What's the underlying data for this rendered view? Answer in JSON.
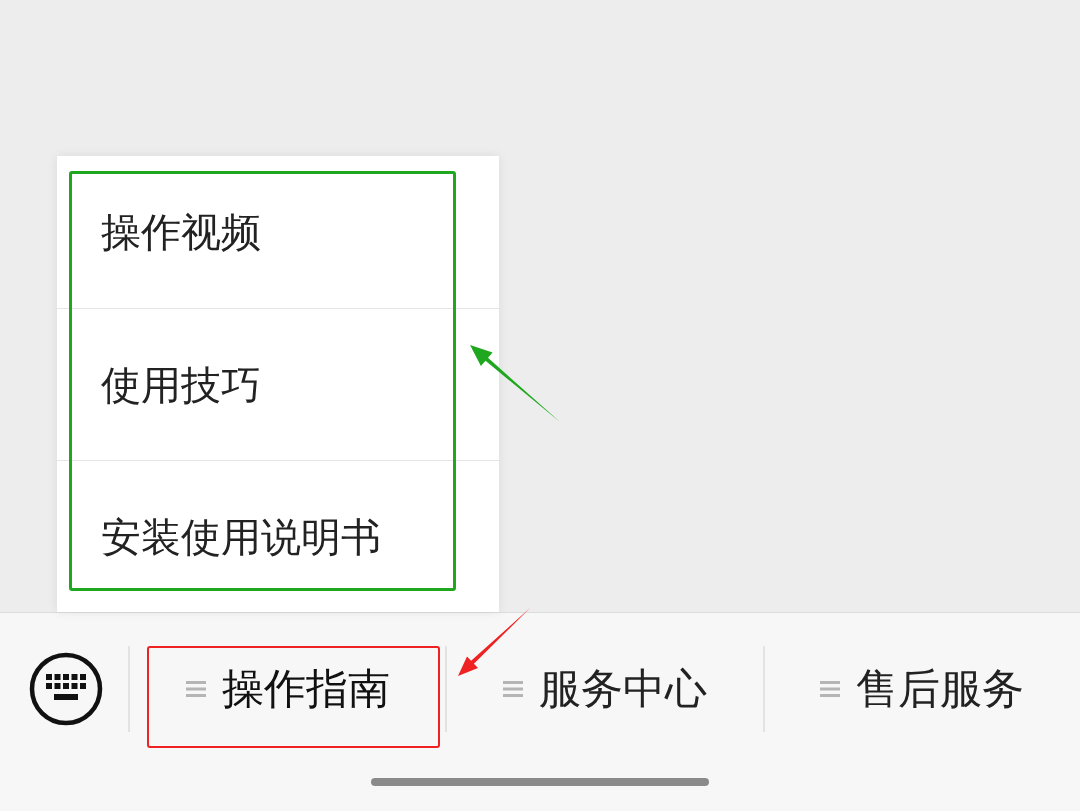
{
  "popup_menu": {
    "highlighted": true,
    "items": [
      {
        "label": "操作视频"
      },
      {
        "label": "使用技巧"
      },
      {
        "label": "安装使用说明书"
      }
    ]
  },
  "menu_bar": {
    "items": [
      {
        "label": "操作指南",
        "expanded": true,
        "highlighted": true
      },
      {
        "label": "服务中心",
        "expanded": false,
        "highlighted": false
      },
      {
        "label": "售后服务",
        "expanded": false,
        "highlighted": false
      }
    ]
  }
}
